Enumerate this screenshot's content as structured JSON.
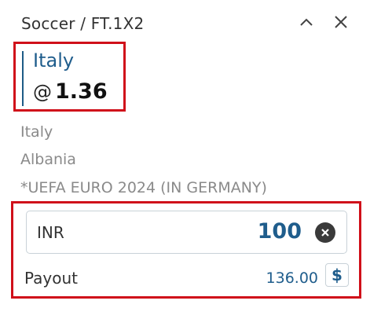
{
  "header": {
    "title": "Soccer / FT.1X2",
    "collapse_icon": "chevron-up-icon",
    "close_icon": "close-icon"
  },
  "selection": {
    "name": "Italy",
    "at": "@",
    "odds": "1.36"
  },
  "event": {
    "home": "Italy",
    "away": "Albania",
    "competition": "*UEFA EURO 2024 (IN GERMANY)"
  },
  "stake": {
    "currency": "INR",
    "amount": "100",
    "clear_icon": "clear-circle-icon"
  },
  "payout": {
    "label": "Payout",
    "value": "136.00",
    "currency_button": "$"
  },
  "colors": {
    "accent": "#1f5d8c",
    "highlight_border": "#d0101a",
    "muted_text": "#8a8a8a"
  }
}
